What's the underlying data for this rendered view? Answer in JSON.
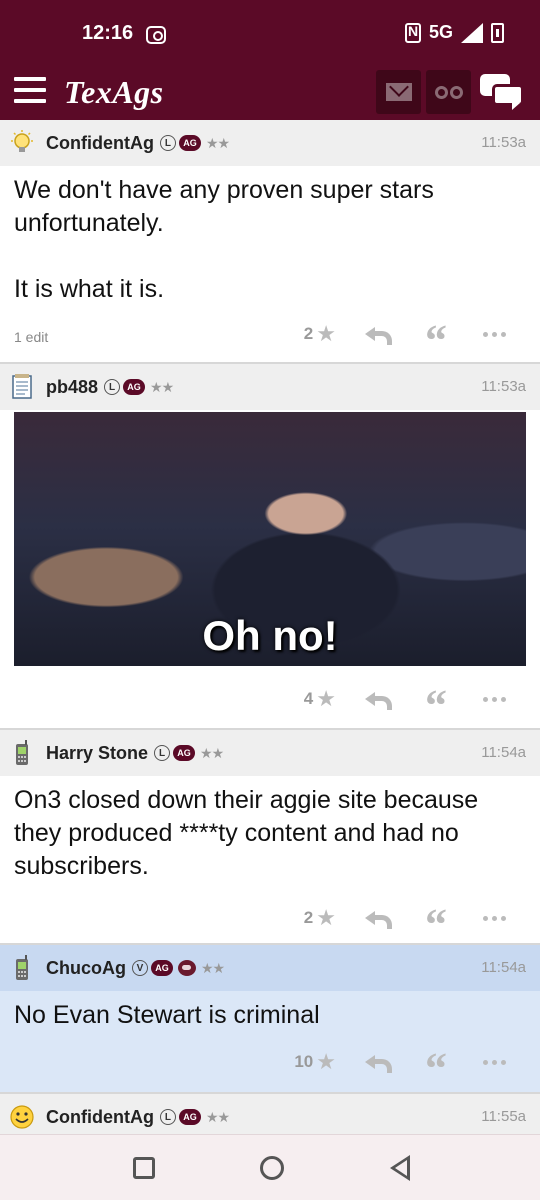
{
  "status_bar": {
    "time": "12:16",
    "network": "5G"
  },
  "header": {
    "logo": "TexAgs"
  },
  "posts": [
    {
      "avatar_icon": "lightbulb-icon",
      "username": "ConfidentAg",
      "badges": [
        "L",
        "AG"
      ],
      "stars": "★★",
      "time": "11:53a",
      "paragraphs": [
        "We don't have any proven super stars unfortunately.",
        "It is what it is."
      ],
      "edit_note": "1 edit",
      "rating": "2"
    },
    {
      "avatar_icon": "notepad-icon",
      "username": "pb488",
      "badges": [
        "L",
        "AG"
      ],
      "stars": "★★",
      "time": "11:53a",
      "image_caption": "Oh no!",
      "rating": "4"
    },
    {
      "avatar_icon": "phone-icon",
      "username": "Harry Stone",
      "badges": [
        "L",
        "AG"
      ],
      "stars": "★★",
      "time": "11:54a",
      "paragraphs": [
        "On3 closed down their aggie site because they produced ****ty content and had no subscribers."
      ],
      "rating": "2"
    },
    {
      "avatar_icon": "phone-icon",
      "username": "ChucoAg",
      "badges": [
        "V",
        "AG"
      ],
      "stars": "★★",
      "time": "11:54a",
      "paragraphs": [
        "No Evan Stewart is criminal"
      ],
      "rating": "10"
    },
    {
      "avatar_icon": "smiley-icon",
      "username": "ConfidentAg",
      "badges": [
        "L",
        "AG"
      ],
      "stars": "★★",
      "time": "11:55a"
    }
  ],
  "colors": {
    "brand": "#5b0a27",
    "highlight": "#dbe7f7"
  }
}
